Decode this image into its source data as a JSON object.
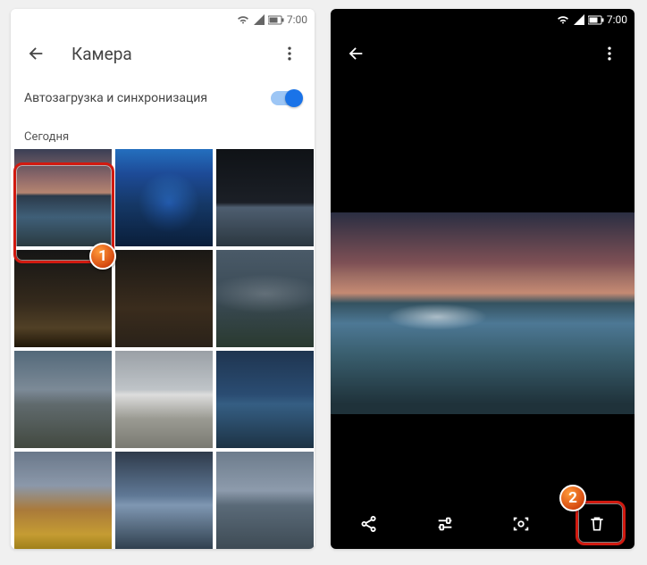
{
  "status": {
    "time": "7:00"
  },
  "left": {
    "title": "Камера",
    "setting_label": "Автозагрузка и синхронизация",
    "setting_on": true,
    "section": "Сегодня",
    "thumbs": [
      {
        "name": "sunset-waterfall"
      },
      {
        "name": "blue-swirl-canyon"
      },
      {
        "name": "night-mountain-lake"
      },
      {
        "name": "dark-lake-sunset"
      },
      {
        "name": "castle-night"
      },
      {
        "name": "rainbow-plain"
      },
      {
        "name": "gray-rock-sea"
      },
      {
        "name": "terraced-falls"
      },
      {
        "name": "blue-cliffs-sea"
      },
      {
        "name": "sunflowers-dusk"
      },
      {
        "name": "wide-waterfall"
      },
      {
        "name": "cloudy-fjord"
      }
    ]
  },
  "right": {
    "actions": [
      "share",
      "edit",
      "lens",
      "delete"
    ]
  },
  "markers": {
    "one": "1",
    "two": "2"
  }
}
